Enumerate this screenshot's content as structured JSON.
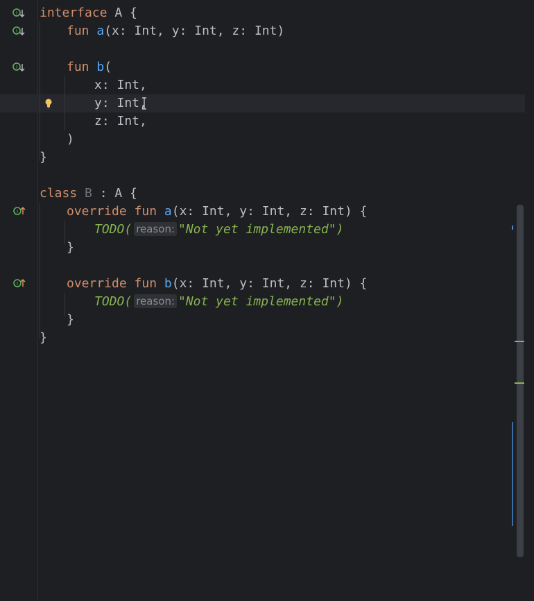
{
  "code": {
    "l1": [
      "interface",
      " A {"
    ],
    "l2": [
      "fun",
      " ",
      "a",
      "(x: Int, y: Int, z: Int)"
    ],
    "l4": [
      "fun",
      " ",
      "b",
      "("
    ],
    "l5": "x: Int,",
    "l6": "y: Int,",
    "l7": "z: Int,",
    "l8": ")",
    "l9": "}",
    "l11": [
      "class",
      " B",
      " : A {"
    ],
    "l12": [
      "override fun",
      " ",
      "a",
      "(x: Int, y: Int, z: Int) {"
    ],
    "l13": [
      "TODO(",
      "reason:",
      "\"Not yet implemented\")"
    ],
    "l14": "}",
    "l16": [
      "override fun",
      " ",
      "b",
      "(x: Int, y: Int, z: Int) {"
    ],
    "l17": [
      "TODO(",
      "reason:",
      "\"Not yet implemented\")"
    ],
    "l18": "}",
    "l19": "}"
  },
  "gutter_icons": [
    "implemented-down-icon",
    "implemented-down-icon",
    "implemented-down-icon",
    "overrides-up-icon",
    "overrides-up-icon"
  ],
  "colors": {
    "background": "#1e1f22",
    "keyword": "#cf8e6d",
    "function": "#56a8f5",
    "text": "#bcbec4",
    "todo": "#87b350",
    "caret_line": "#26282e"
  }
}
